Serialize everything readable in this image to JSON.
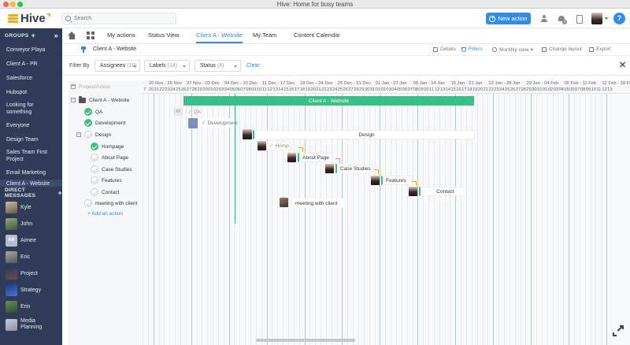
{
  "window": {
    "title": "Hive: Home for busy teams"
  },
  "topbar": {
    "logo_text": "Hive",
    "search_placeholder": "Search",
    "new_action_label": "New action",
    "notification_count": "2",
    "accent": "#2f8ce8"
  },
  "sidebar": {
    "groups_label": "GROUPS",
    "groups": [
      "Conveyor Playa",
      "Client A - PR",
      "Salesforce",
      "Hubspot",
      "Looking for something",
      "Everyone",
      "Design Team",
      "Sales Team First Project",
      "Email Marketing",
      "Client A - Website"
    ],
    "dm_label": "DIRECT MESSAGES",
    "dms": [
      "Kyle",
      "John",
      "Aimee",
      "Eric",
      "Project",
      "Strategy",
      "Erin",
      "Media Planning"
    ],
    "aimee_initials": "AR",
    "bg_color": "#2f3b57"
  },
  "nav": {
    "tabs": [
      "My actions",
      "Status View",
      "Client A - Website",
      "My Team",
      "Content Calendar"
    ],
    "active_tab": "Client A - Website"
  },
  "subheader": {
    "title": "Client A - Website",
    "details": "Details",
    "filters": "Filters",
    "view": "Monthly view",
    "change_layout": "Change layout",
    "export": "Export"
  },
  "filterbar": {
    "label": "Filter By",
    "assignees": "Assignees",
    "assignees_count": "(10)",
    "labels": "Labels",
    "labels_count": "(14)",
    "status": "Status",
    "status_count": "(4)",
    "clear": "Clear"
  },
  "gantt": {
    "column_header": "Project/Action",
    "weeks": [
      "20 Nov - 26 Nov",
      "27 Nov - 03 Dec",
      "04 Dec - 10 Dec",
      "11 Dec - 17 Dec",
      "18 Dec - 24 Dec",
      "25 Dec - 31 Dec",
      "01 Jan - 07 Jan",
      "08 Jan - 14 Jan",
      "15 Jan - 21 Jan",
      "22 Jan - 28 Jan",
      "29 Jan - 04 Feb",
      "05 Feb - 11 Feb",
      "12 Feb - 18 Feb"
    ],
    "days": [
      "7",
      "20",
      "21",
      "22",
      "23",
      "24",
      "25",
      "26",
      "27",
      "28",
      "29",
      "30",
      "01",
      "02",
      "03",
      "04",
      "05",
      "06",
      "07",
      "08",
      "09",
      "10",
      "11",
      "12",
      "13",
      "14",
      "15",
      "16",
      "17",
      "18",
      "19",
      "20",
      "21",
      "22",
      "23",
      "24",
      "25",
      "26",
      "27",
      "28",
      "29",
      "30",
      "31",
      "01",
      "02",
      "03",
      "04",
      "05",
      "06",
      "07",
      "08",
      "09",
      "10",
      "11",
      "12",
      "13",
      "14",
      "15",
      "16",
      "17",
      "18",
      "19",
      "20",
      "21",
      "22",
      "23",
      "24",
      "25",
      "26",
      "27",
      "28",
      "29",
      "30",
      "31",
      "01",
      "02",
      "03",
      "04",
      "05",
      "06",
      "07",
      "08",
      "09",
      "10",
      "11",
      "12",
      "13"
    ],
    "rows": {
      "project": "Client A - Website",
      "qa": "QA",
      "development": "Development",
      "design": "Design",
      "homepage": "Hompage",
      "about": "About Page",
      "case": "Case Studies",
      "features": "Features",
      "contact": "Contact",
      "meeting": "meeting with client"
    },
    "add_action": "+ Add an action",
    "bars": {
      "project": "Client A - Website",
      "qa": "QA",
      "development": "Development",
      "design": "Design",
      "homepage": "Homp",
      "about": "About Page",
      "case": "Case Studies",
      "features": "Features",
      "contact": "Contact",
      "meeting": "meeting with client"
    },
    "all_badge": "All",
    "green": "#3bbf8a"
  }
}
